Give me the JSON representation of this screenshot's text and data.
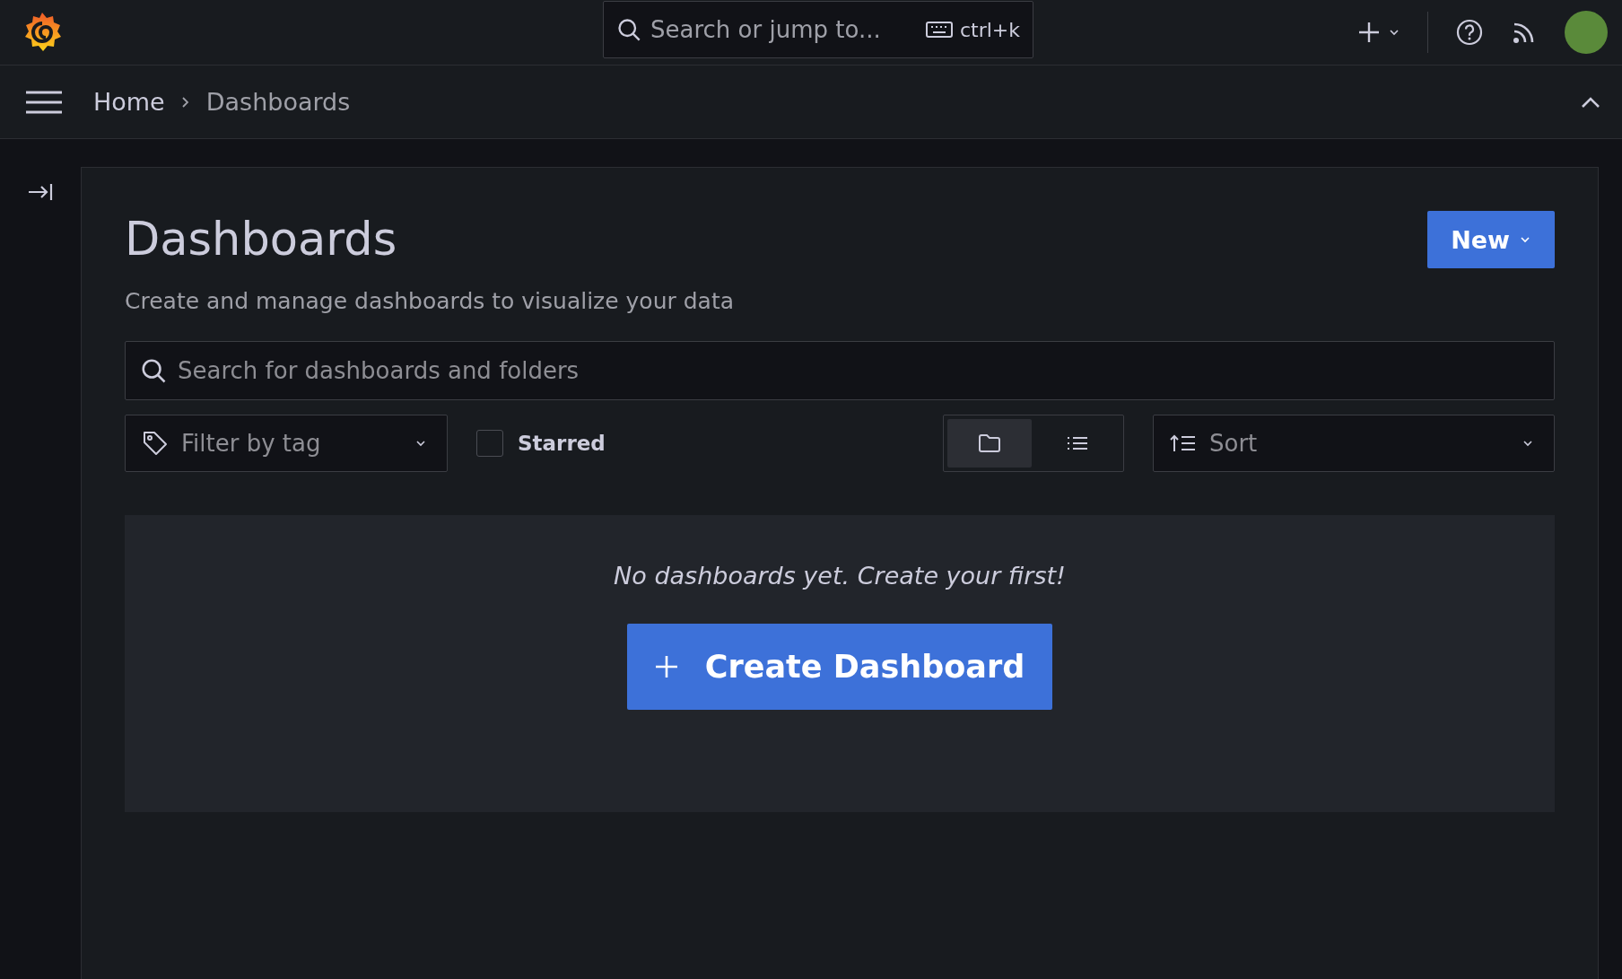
{
  "top_bar": {
    "search": {
      "placeholder": "Search or jump to...",
      "shortcut": "ctrl+k"
    }
  },
  "breadcrumbs": [
    {
      "label": "Home",
      "current": false
    },
    {
      "label": "Dashboards",
      "current": true
    }
  ],
  "page": {
    "title": "Dashboards",
    "subtitle": "Create and manage dashboards to visualize your data",
    "new_button": "New"
  },
  "search": {
    "placeholder": "Search for dashboards and folders"
  },
  "filters": {
    "tag_filter": {
      "placeholder": "Filter by tag"
    },
    "starred": {
      "label": "Starred",
      "checked": false
    },
    "view_modes": [
      {
        "kind": "folder",
        "selected": true
      },
      {
        "kind": "list",
        "selected": false
      }
    ],
    "sort": {
      "placeholder": "Sort"
    }
  },
  "empty_state": {
    "message": "No dashboards yet. Create your first!",
    "button": "Create Dashboard"
  }
}
